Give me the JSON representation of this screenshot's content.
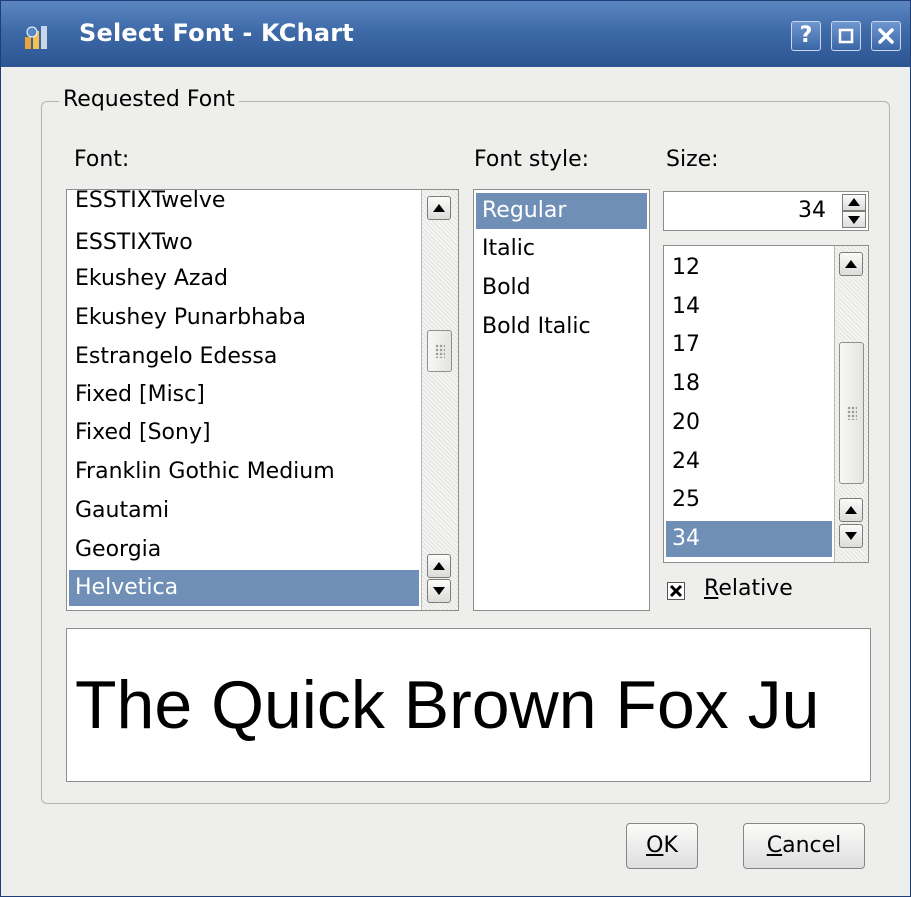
{
  "window": {
    "title": "Select Font - KChart",
    "buttons": {
      "help": "?",
      "maximize": "□",
      "close": "✕"
    }
  },
  "group": {
    "title": "Requested Font"
  },
  "font": {
    "label": "Font:",
    "items": [
      "ESSTIXTwelve",
      "ESSTIXTwo",
      "Ekushey Azad",
      "Ekushey Punarbhaba",
      "Estrangelo Edessa",
      "Fixed [Misc]",
      "Fixed [Sony]",
      "Franklin Gothic Medium",
      "Gautami",
      "Georgia",
      "Helvetica"
    ],
    "selected": "Helvetica"
  },
  "style": {
    "label": "Font style:",
    "items": [
      "Regular",
      "Italic",
      "Bold",
      "Bold Italic"
    ],
    "selected": "Regular"
  },
  "size": {
    "label": "Size:",
    "value": "34",
    "items": [
      "12",
      "14",
      "17",
      "18",
      "20",
      "24",
      "25",
      "34"
    ],
    "selected": "34"
  },
  "relative": {
    "mnemonic": "R",
    "rest": "elative",
    "checked": true
  },
  "preview": {
    "text": "The Quick Brown Fox Ju"
  },
  "actions": {
    "ok": {
      "mnemonic": "O",
      "rest": "K"
    },
    "cancel": {
      "mnemonic": "C",
      "rest": "ancel"
    }
  },
  "colors": {
    "selection": "#6f8fb6",
    "titlebar": "#3e6aa8"
  }
}
